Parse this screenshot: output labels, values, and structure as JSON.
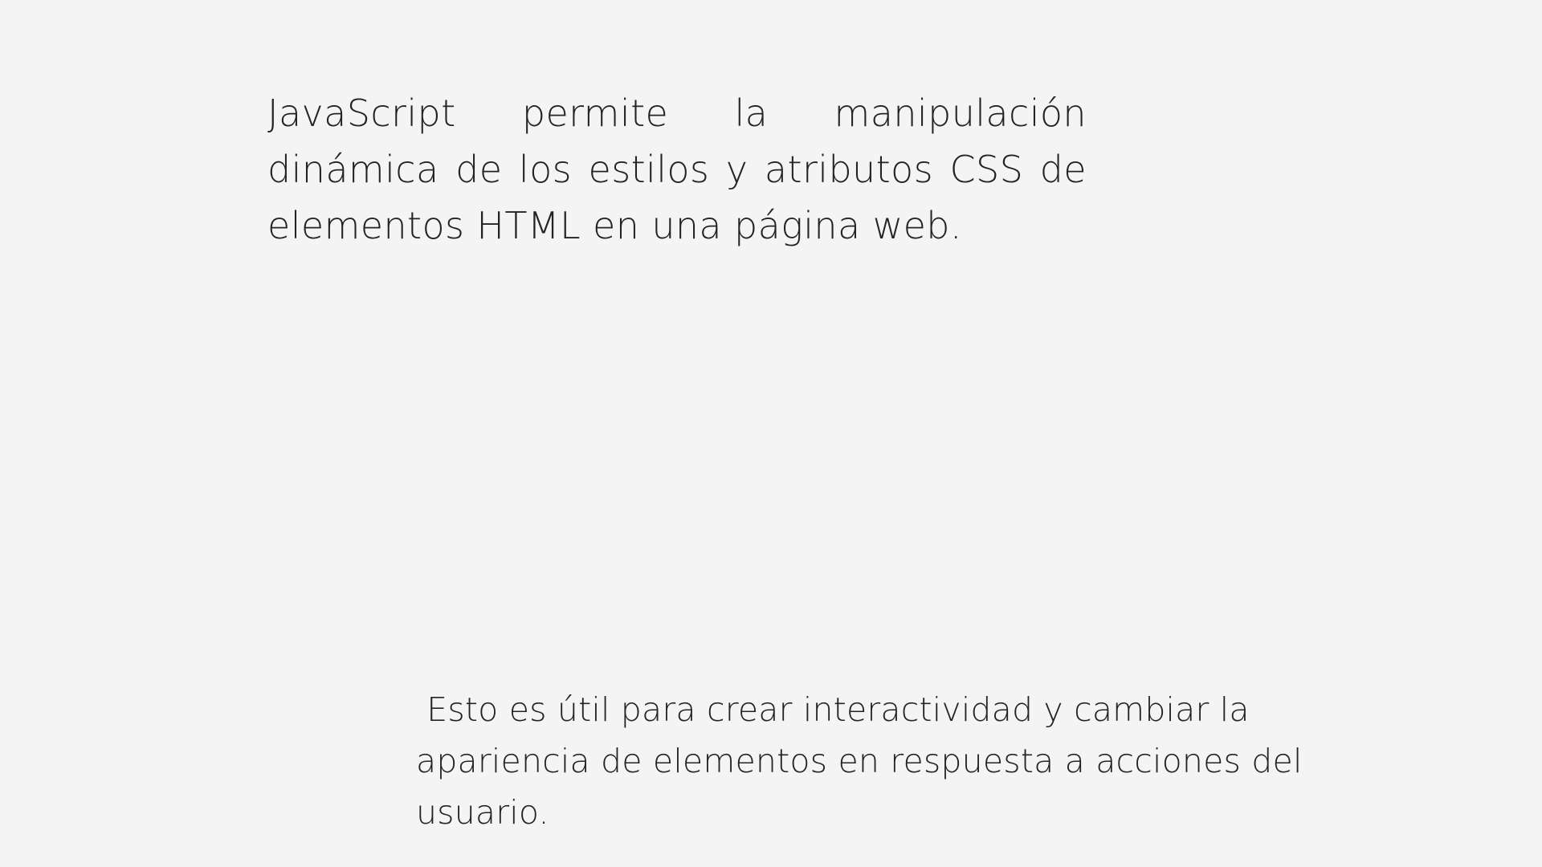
{
  "slide": {
    "paragraph_top": "JavaScript permite la manipulación dinámica de los estilos y atributos CSS de elementos HTML en una página web.",
    "paragraph_bottom": " Esto es útil para crear interactividad y cambiar la apariencia de elementos en respuesta a acciones del usuario."
  },
  "colors": {
    "background": "#f4f4f4",
    "text": "#232323"
  }
}
